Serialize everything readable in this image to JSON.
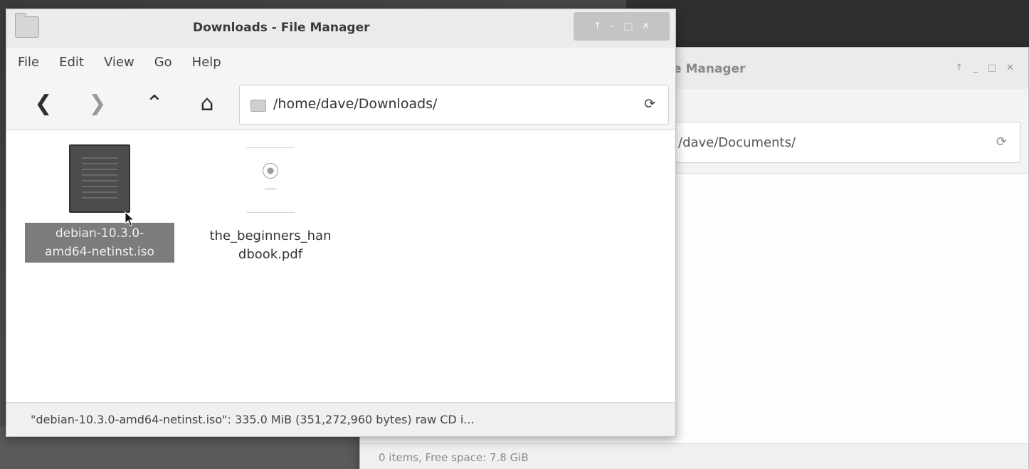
{
  "back_window": {
    "title": "e Manager",
    "path": "/dave/Documents/",
    "reload_glyph": "⟳",
    "status": "0 items, Free space: 7.8 GiB",
    "wm": {
      "stick": "↑",
      "minimize": "_",
      "maximize": "□",
      "close": "✕"
    }
  },
  "front_window": {
    "title": "Downloads - File Manager",
    "wm": {
      "stick": "↑",
      "minimize": "–",
      "maximize": "□",
      "close": "✕"
    },
    "menu": [
      "File",
      "Edit",
      "View",
      "Go",
      "Help"
    ],
    "toolbar": {
      "back_glyph": "❮",
      "forward_glyph": "❯",
      "up_glyph": "⌃",
      "home_glyph": "⌂",
      "path": "/home/dave/Downloads/",
      "reload_glyph": "⟳"
    },
    "files": [
      {
        "name_line1": "debian-10.3.0-",
        "name_line2": "amd64-netinst.iso",
        "icon": "iso-file-icon",
        "selected": true
      },
      {
        "name_line1": "the_beginners_han",
        "name_line2": "dbook.pdf",
        "icon": "pdf-file-icon",
        "selected": false
      }
    ],
    "status": "\"debian-10.3.0-amd64-netinst.iso\": 335.0 MiB (351,272,960 bytes) raw CD i..."
  },
  "colors": {
    "selection": "#7c7c7c",
    "desktop": "#4a4a4a"
  }
}
